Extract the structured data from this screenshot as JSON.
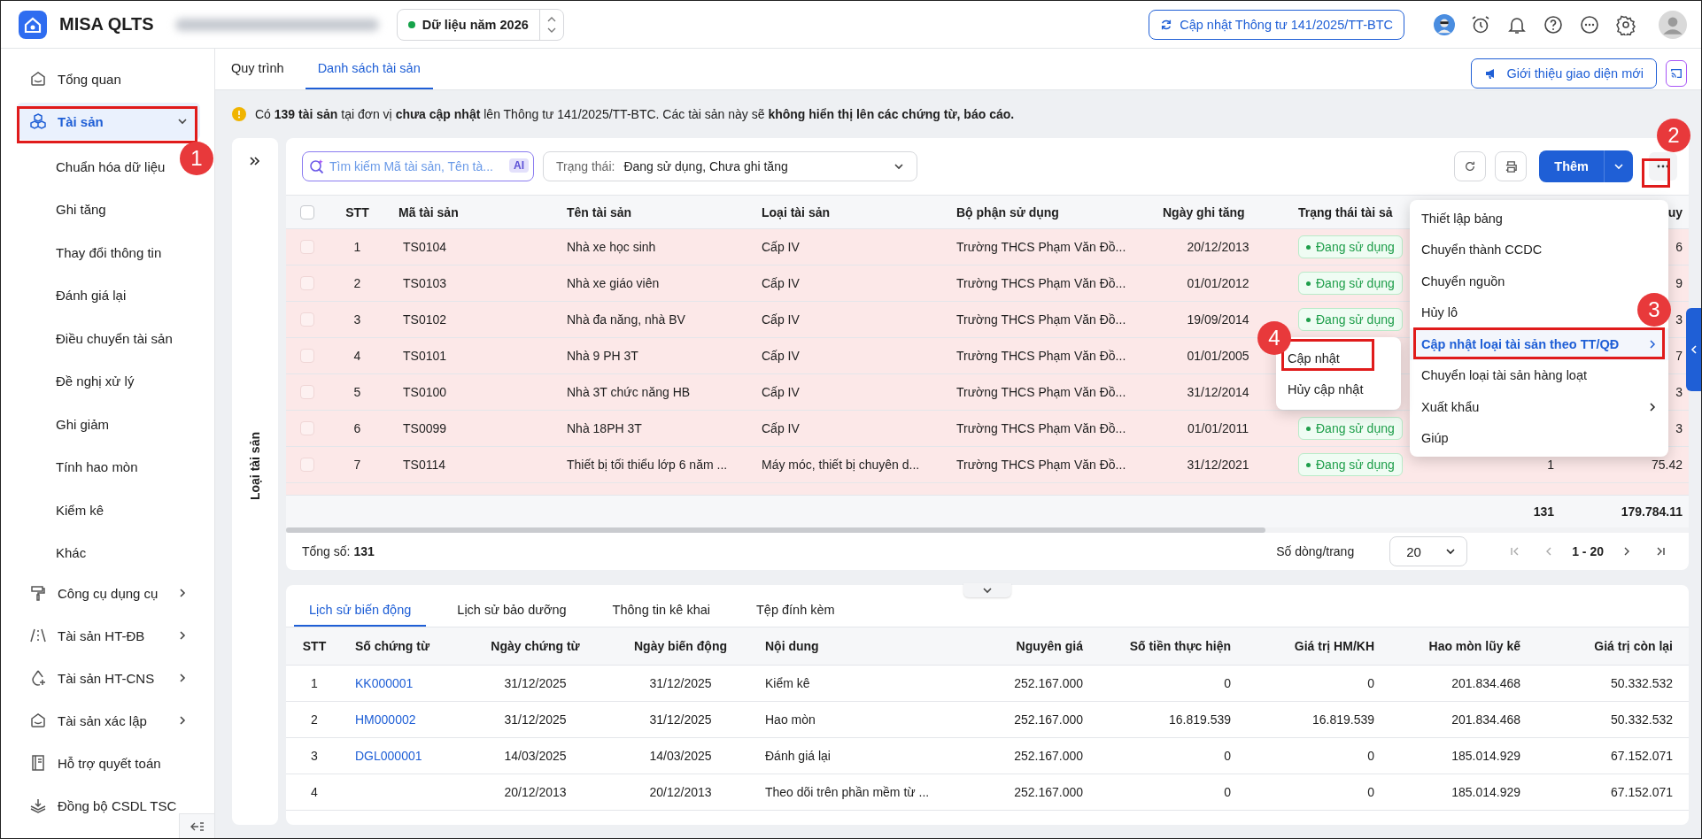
{
  "topbar": {
    "app_name": "MISA QLTS",
    "year_selector": "Dữ liệu năm 2026",
    "update_button": "Cập nhật Thông tư 141/2025/TT-BTC"
  },
  "sidebar": {
    "items": [
      {
        "label": "Tổng quan",
        "kind": "link",
        "selected": false
      },
      {
        "label": "Tài sản",
        "kind": "group",
        "selected": true,
        "expanded": true,
        "children": [
          {
            "label": "Chuẩn hóa dữ liệu"
          },
          {
            "label": "Ghi tăng"
          },
          {
            "label": "Thay đổi thông tin"
          },
          {
            "label": "Đánh giá lại"
          },
          {
            "label": "Điều chuyển tài sản"
          },
          {
            "label": "Đề nghị xử lý"
          },
          {
            "label": "Ghi giảm"
          },
          {
            "label": "Tính hao mòn"
          },
          {
            "label": "Kiểm kê"
          },
          {
            "label": "Khác"
          }
        ]
      },
      {
        "label": "Công cụ dụng cụ",
        "kind": "group",
        "selected": false,
        "expanded": false
      },
      {
        "label": "Tài sản HT-ĐB",
        "kind": "group",
        "selected": false,
        "expanded": false
      },
      {
        "label": "Tài sản HT-CNS",
        "kind": "group",
        "selected": false,
        "expanded": false
      },
      {
        "label": "Tài sản xác lập",
        "kind": "group",
        "selected": false,
        "expanded": false
      },
      {
        "label": "Hỗ trợ quyết toán",
        "kind": "link",
        "selected": false
      },
      {
        "label": "Đồng bộ CSDL TSC",
        "kind": "link",
        "selected": false
      }
    ]
  },
  "page_tabs": [
    {
      "label": "Quy trình",
      "selected": false
    },
    {
      "label": "Danh sách tài sản",
      "selected": true
    }
  ],
  "intro_button": "Giới thiệu giao diện mới",
  "notice": "Có **139 tài sản** tại đơn vị **chưa cập nhật** lên Thông tư 141/2025/TT-BTC. Các tài sản này sẽ **không hiển thị lên các chứng từ, báo cáo.**",
  "side_panel": {
    "title": "Loại tài sản"
  },
  "toolbar": {
    "search": {
      "placeholder": "Tìm kiếm Mã tài sản, Tên tà...",
      "badge": "AI"
    },
    "status_filter": {
      "label": "Trạng thái:",
      "value": "Đang sử dụng, Chưa ghi tăng"
    },
    "add_button": "Thêm"
  },
  "asset_table": {
    "select_all_checked": false,
    "columns": [
      "STT",
      "Mã tài sản",
      "Tên tài sản",
      "Loại tài sản",
      "Bộ phận sử dụng",
      "Ngày ghi tăng",
      "Trạng thái tài sả"
    ],
    "column_10": {
      "header": "uy"
    },
    "rows": [
      {
        "checked": false,
        "highlighted": true,
        "stt": "1",
        "code": "TS0104",
        "name": "Nhà xe học sinh",
        "type": "Cấp IV",
        "department": "Trường THCS Phạm Văn Đồ...",
        "date": "20/12/2013",
        "status": "Đang sử dụng",
        "column_10": "6"
      },
      {
        "checked": false,
        "highlighted": true,
        "stt": "2",
        "code": "TS0103",
        "name": "Nhà xe giáo viên",
        "type": "Cấp IV",
        "department": "Trường THCS Phạm Văn Đồ...",
        "date": "01/01/2012",
        "status": "Đang sử dụng",
        "column_10": "9"
      },
      {
        "checked": false,
        "highlighted": true,
        "stt": "3",
        "code": "TS0102",
        "name": "Nhà đa năng, nhà BV",
        "type": "Cấp IV",
        "department": "Trường THCS Phạm Văn Đồ...",
        "date": "19/09/2014",
        "status": "Đang sử dụng",
        "column_10": "3"
      },
      {
        "checked": false,
        "highlighted": true,
        "stt": "4",
        "code": "TS0101",
        "name": "Nhà 9 PH 3T",
        "type": "Cấp IV",
        "department": "Trường THCS Phạm Văn Đồ...",
        "date": "01/01/2005",
        "column_10": "7"
      },
      {
        "checked": false,
        "highlighted": true,
        "stt": "5",
        "code": "TS0100",
        "name": "Nhà 3T chức năng HB",
        "type": "Cấp IV",
        "department": "Trường THCS Phạm Văn Đồ...",
        "date": "31/12/2014",
        "column_10": "3"
      },
      {
        "checked": false,
        "highlighted": true,
        "stt": "6",
        "code": "TS0099",
        "name": "Nhà 18PH 3T",
        "type": "Cấp IV",
        "department": "Trường THCS Phạm Văn Đồ...",
        "date": "01/01/2011",
        "status": "Đang sử dụng",
        "column_10": "3"
      },
      {
        "checked": false,
        "highlighted": true,
        "stt": "7",
        "code": "TS0114",
        "name": "Thiết bị tối thiểu lớp 6 năm ...",
        "type": "Máy móc, thiết bị chuyên d...",
        "department": "Trường THCS Phạm Văn Đồ...",
        "date": "31/12/2021",
        "status": "Đang sử dụng",
        "column_9": "1",
        "column_10": "75.42"
      }
    ],
    "totals": {
      "column_9": "131",
      "column_10": "179.784.11"
    },
    "footer": {
      "total": "Tổng số: **131**",
      "rows_per_page_label": "Số dòng/trang",
      "rows_per_page": "20",
      "range": "1 - 20"
    }
  },
  "more_menu": {
    "items": [
      {
        "label": "Thiết lập bảng",
        "kind": "item",
        "highlighted": false
      },
      {
        "label": "Chuyển thành CCDC",
        "kind": "item",
        "highlighted": false
      },
      {
        "label": "Chuyển nguồn",
        "kind": "item",
        "highlighted": false
      },
      {
        "label": "Hủy lô",
        "kind": "item",
        "highlighted": false
      },
      {
        "label": "Cập nhật loại tài sản theo TT/QĐ",
        "kind": "submenu",
        "highlighted": true
      },
      {
        "label": "Chuyển loại tài sản hàng loạt",
        "kind": "item",
        "highlighted": false
      },
      {
        "label": "Xuất khẩu",
        "kind": "submenu",
        "highlighted": false
      },
      {
        "label": "Giúp",
        "kind": "item",
        "highlighted": false
      }
    ]
  },
  "submenu": {
    "items": [
      {
        "label": "Cập nhật"
      },
      {
        "label": "Hủy cập nhật"
      }
    ]
  },
  "detail_tabs": [
    {
      "label": "Lịch sử biến động",
      "selected": true
    },
    {
      "label": "Lịch sử bảo dưỡng",
      "selected": false
    },
    {
      "label": "Thông tin kê khai",
      "selected": false
    },
    {
      "label": "Tệp đính kèm",
      "selected": false
    }
  ],
  "history_table": {
    "columns": [
      "STT",
      "Số chứng từ",
      "Ngày chứng từ",
      "Ngày biến động",
      "Nội dung",
      "Nguyên giá",
      "Số tiền thực hiện",
      "Giá trị HM/KH",
      "Hao mòn lũy kế",
      "Giá trị còn lại"
    ],
    "rows": [
      {
        "stt": "1",
        "voucher": "KK000001",
        "voucher_date": "31/12/2025",
        "change_date": "31/12/2025",
        "content": "Kiểm kê",
        "cost": "252.167.000",
        "amount": "0",
        "depreciation": "0",
        "accumulated": "201.834.468",
        "remaining": "50.332.532"
      },
      {
        "stt": "2",
        "voucher": "HM000002",
        "voucher_date": "31/12/2025",
        "change_date": "31/12/2025",
        "content": "Hao mòn",
        "cost": "252.167.000",
        "amount": "16.819.539",
        "depreciation": "16.819.539",
        "accumulated": "201.834.468",
        "remaining": "50.332.532"
      },
      {
        "stt": "3",
        "voucher": "DGL000001",
        "voucher_date": "14/03/2025",
        "change_date": "14/03/2025",
        "content": "Đánh giá lại",
        "cost": "252.167.000",
        "amount": "0",
        "depreciation": "0",
        "accumulated": "185.014.929",
        "remaining": "67.152.071"
      },
      {
        "stt": "4",
        "voucher_date": "20/12/2013",
        "change_date": "20/12/2013",
        "content": "Theo dõi trên phần mềm từ ...",
        "cost": "252.167.000",
        "amount": "0",
        "depreciation": "0",
        "accumulated": "185.014.929",
        "remaining": "67.152.071"
      }
    ]
  },
  "annotations": [
    {
      "label": "1"
    },
    {
      "label": "2"
    },
    {
      "label": "3"
    },
    {
      "label": "4"
    }
  ]
}
